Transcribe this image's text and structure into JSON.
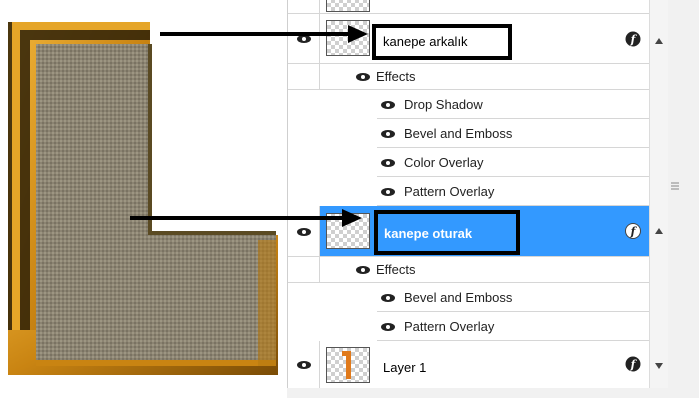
{
  "layers_panel": {
    "layers": [
      {
        "name": "kanepe arkalık",
        "effects_label": "Effects",
        "effects": [
          "Drop Shadow",
          "Bevel and Emboss",
          "Color Overlay",
          "Pattern Overlay"
        ]
      },
      {
        "name": "kanepe oturak",
        "selected": true,
        "effects_label": "Effects",
        "effects": [
          "Bevel and Emboss",
          "Pattern Overlay"
        ]
      },
      {
        "name": "Layer 1"
      }
    ]
  },
  "colors": {
    "selection": "#3399ff",
    "sofa_frame": "#d08a18",
    "sofa_fabric": "#8a8270",
    "highlight_box": "#000000"
  },
  "icons": [
    "eye-icon",
    "fx-icon",
    "scroll-up-arrow-icon",
    "scroll-down-arrow-icon",
    "resize-grip-icon",
    "arrow-icon"
  ]
}
